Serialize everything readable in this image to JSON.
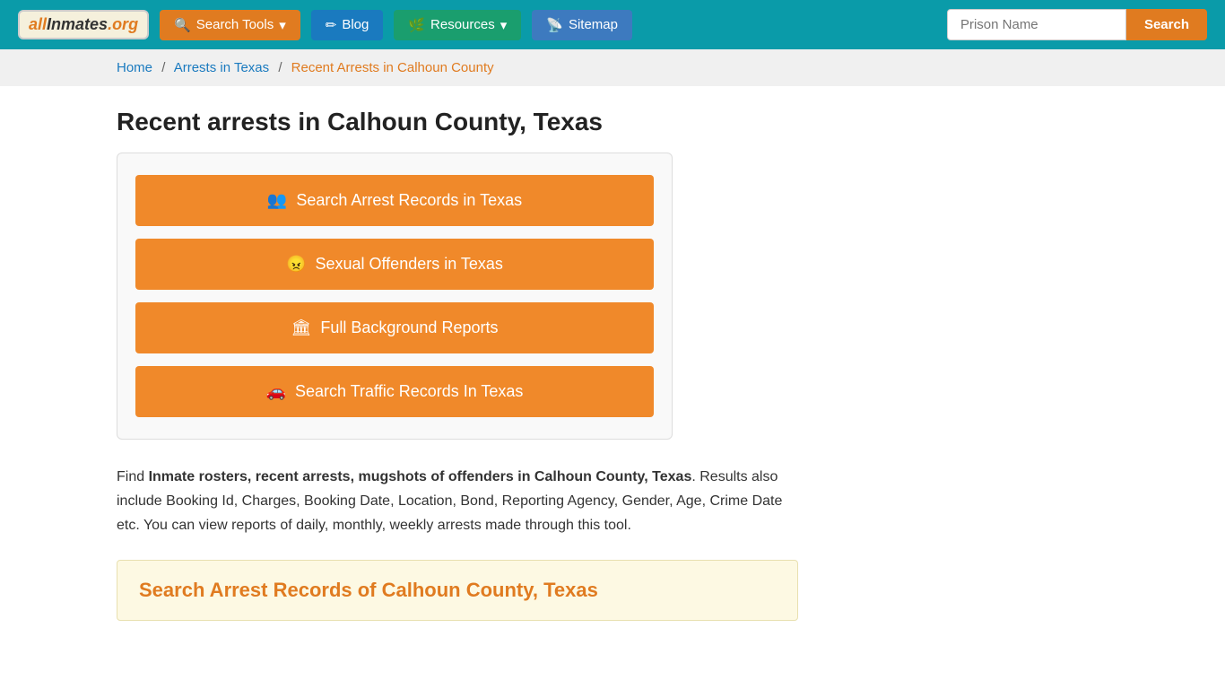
{
  "header": {
    "logo_text": "allInmates.org",
    "logo_all": "all",
    "logo_inmates": "Inmates",
    "logo_org": ".org",
    "nav": [
      {
        "id": "search-tools",
        "label": "Search Tools",
        "icon": "search-icon",
        "style": "orange"
      },
      {
        "id": "blog",
        "label": "Blog",
        "icon": "blog-icon",
        "style": "blue"
      },
      {
        "id": "resources",
        "label": "Resources",
        "icon": "resources-icon",
        "style": "teal"
      },
      {
        "id": "sitemap",
        "label": "Sitemap",
        "icon": "sitemap-icon",
        "style": "blue2"
      }
    ],
    "search_placeholder": "Prison Name",
    "search_button": "Search"
  },
  "breadcrumb": {
    "home": "Home",
    "arrests_texas": "Arrests in Texas",
    "current": "Recent Arrests in Calhoun County"
  },
  "main": {
    "page_title": "Recent arrests in Calhoun County, Texas",
    "action_buttons": [
      {
        "id": "btn-arrest",
        "icon": "people-icon",
        "label": "Search Arrest Records in Texas"
      },
      {
        "id": "btn-offenders",
        "icon": "angry-icon",
        "label": "Sexual Offenders in Texas"
      },
      {
        "id": "btn-background",
        "icon": "building-icon",
        "label": "Full Background Reports"
      },
      {
        "id": "btn-traffic",
        "icon": "car-icon",
        "label": "Search Traffic Records In Texas"
      }
    ],
    "description_start": "Find ",
    "description_bold": "Inmate rosters, recent arrests, mugshots of offenders in Calhoun County, Texas",
    "description_end": ". Results also include Booking Id, Charges, Booking Date, Location, Bond, Reporting Agency, Gender, Age, Crime Date etc. You can view reports of daily, monthly, weekly arrests made through this tool.",
    "search_section_title": "Search Arrest Records of Calhoun County, Texas"
  }
}
